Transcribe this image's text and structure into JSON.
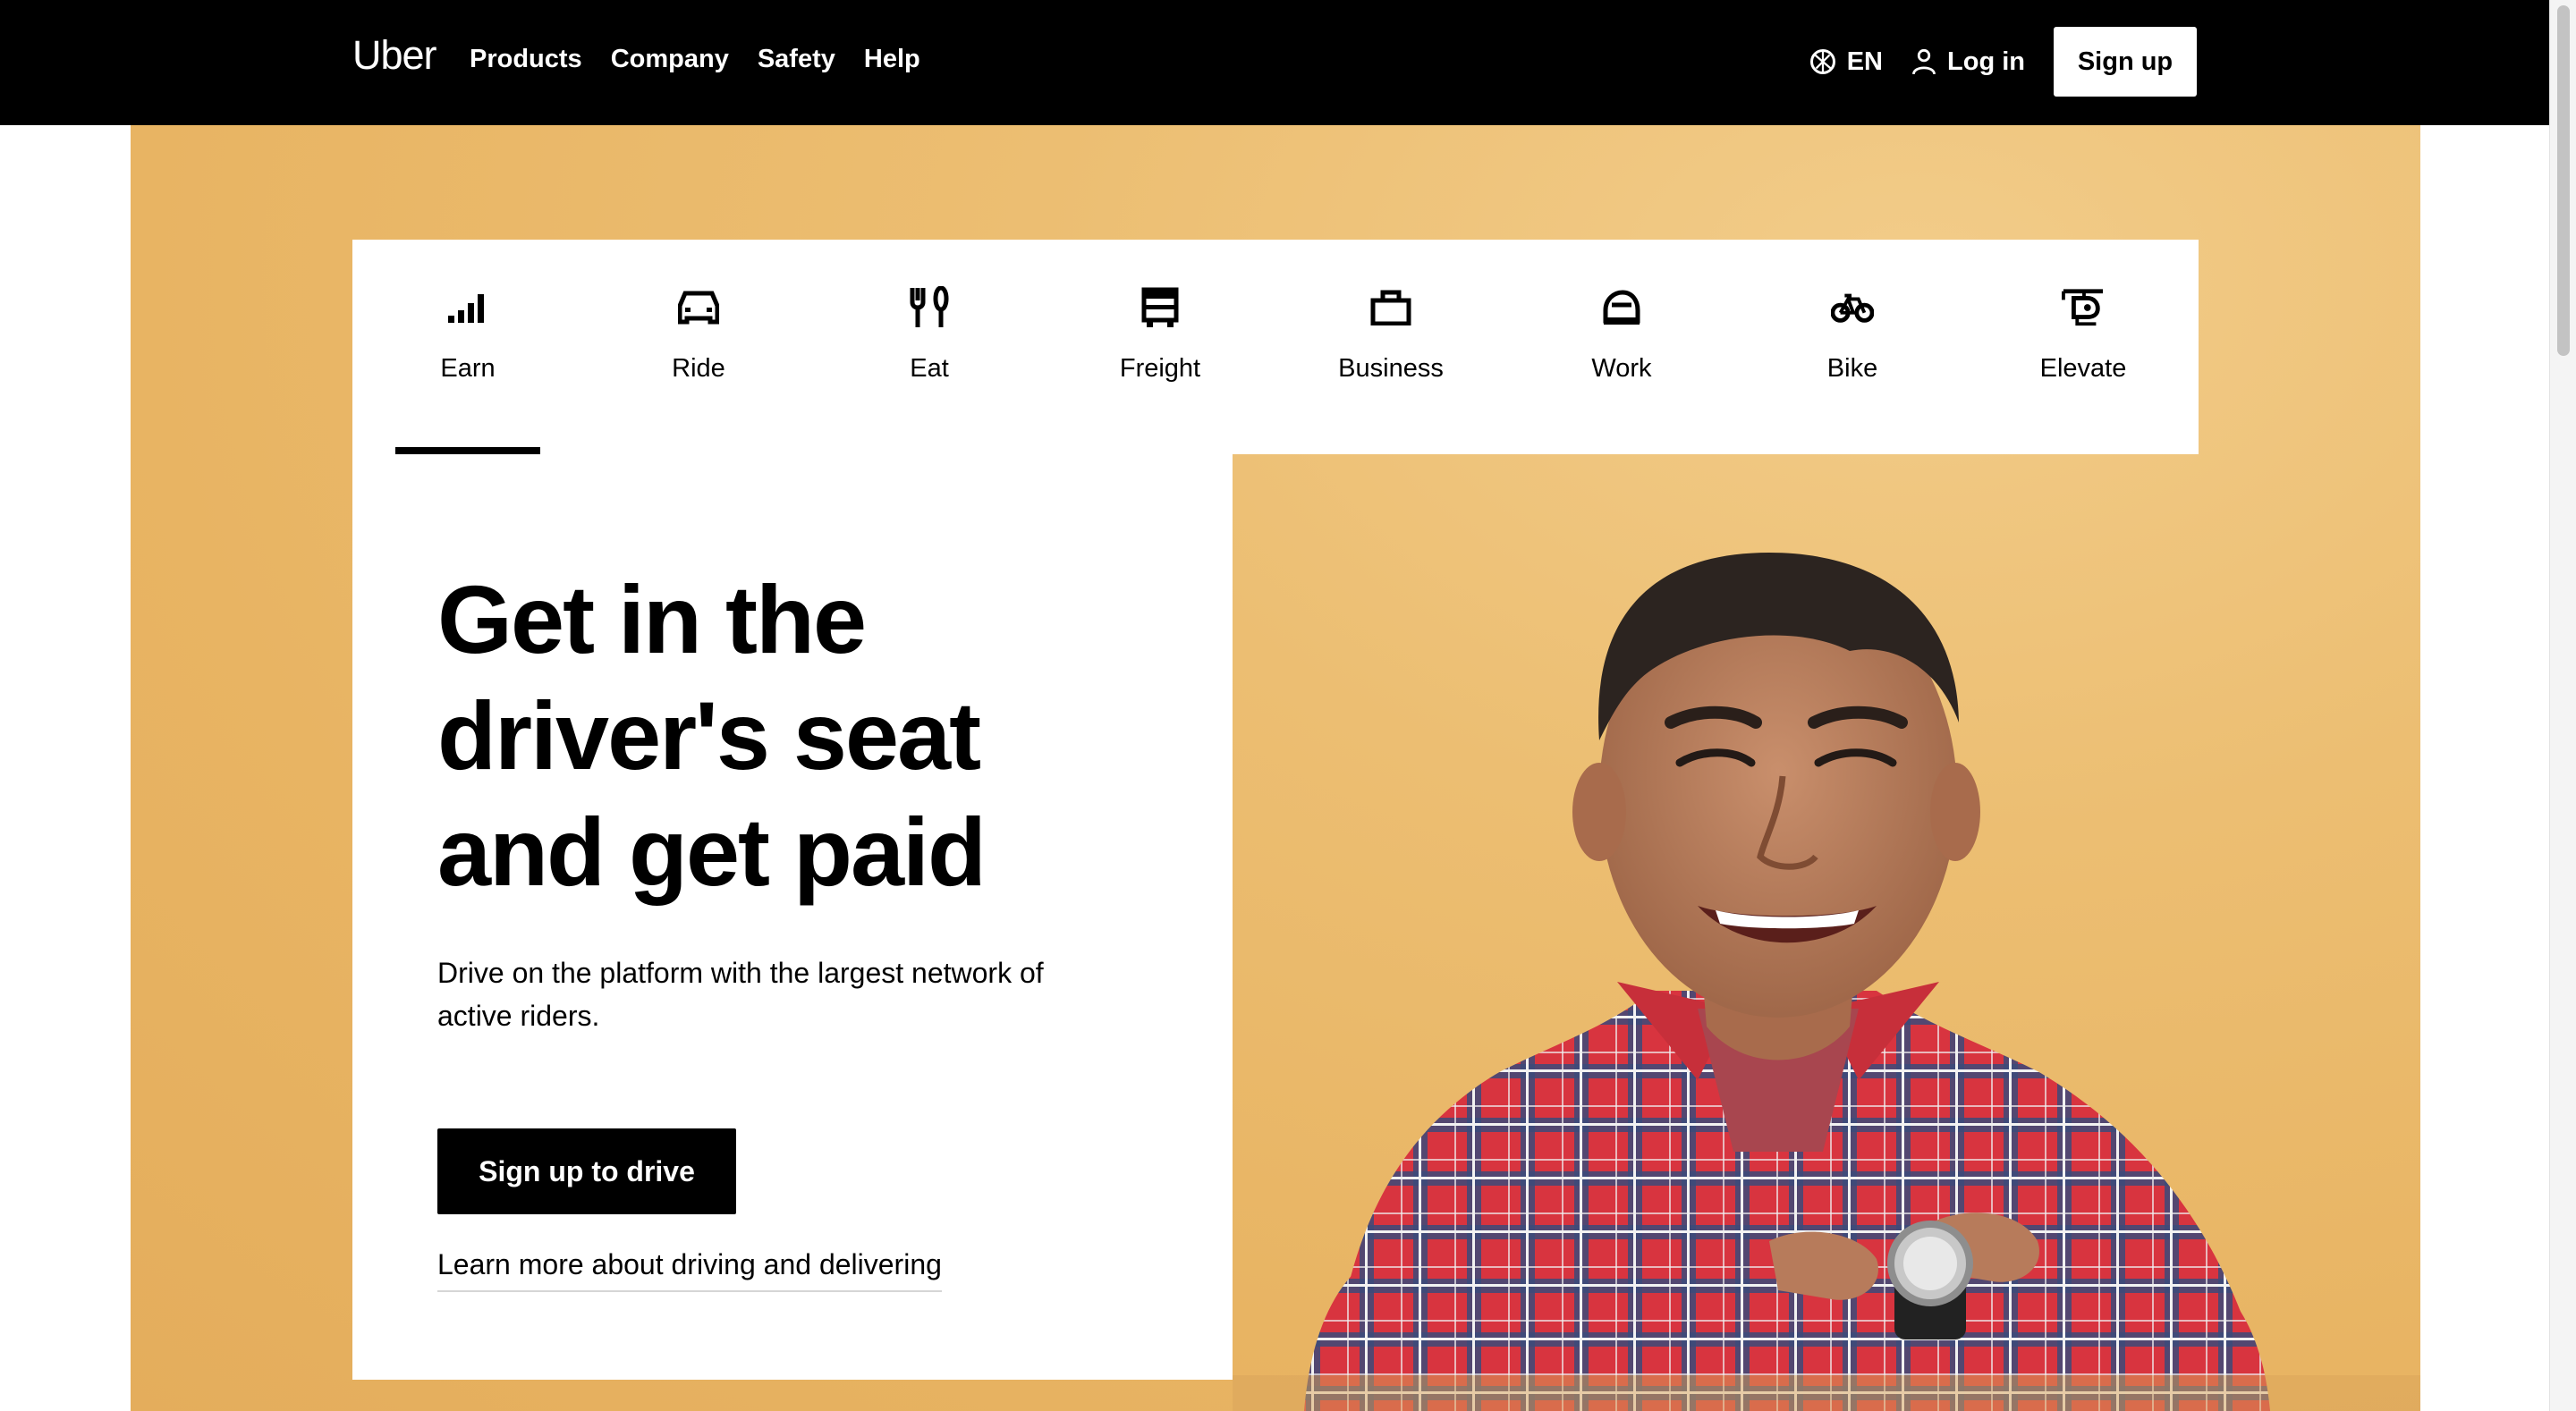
{
  "nav": {
    "brand": "Uber",
    "links": [
      "Products",
      "Company",
      "Safety",
      "Help"
    ],
    "language": "EN",
    "login": "Log in",
    "signup": "Sign up"
  },
  "tabs": [
    {
      "label": "Earn",
      "icon": "earn-signal-icon",
      "active": true
    },
    {
      "label": "Ride",
      "icon": "car-icon",
      "active": false
    },
    {
      "label": "Eat",
      "icon": "fork-knife-icon",
      "active": false
    },
    {
      "label": "Freight",
      "icon": "truck-icon",
      "active": false
    },
    {
      "label": "Business",
      "icon": "briefcase-icon",
      "active": false
    },
    {
      "label": "Work",
      "icon": "hard-hat-icon",
      "active": false
    },
    {
      "label": "Bike",
      "icon": "bicycle-icon",
      "active": false
    },
    {
      "label": "Elevate",
      "icon": "helicopter-icon",
      "active": false
    }
  ],
  "hero": {
    "title": "Get in the driver's seat and get paid",
    "subtitle": "Drive on the platform with the largest network of active riders.",
    "cta": "Sign up to drive",
    "link": "Learn more about driving and delivering"
  },
  "colors": {
    "nav_bg": "#000000",
    "hero_bg": "#e8b463",
    "accent": "#000000"
  }
}
